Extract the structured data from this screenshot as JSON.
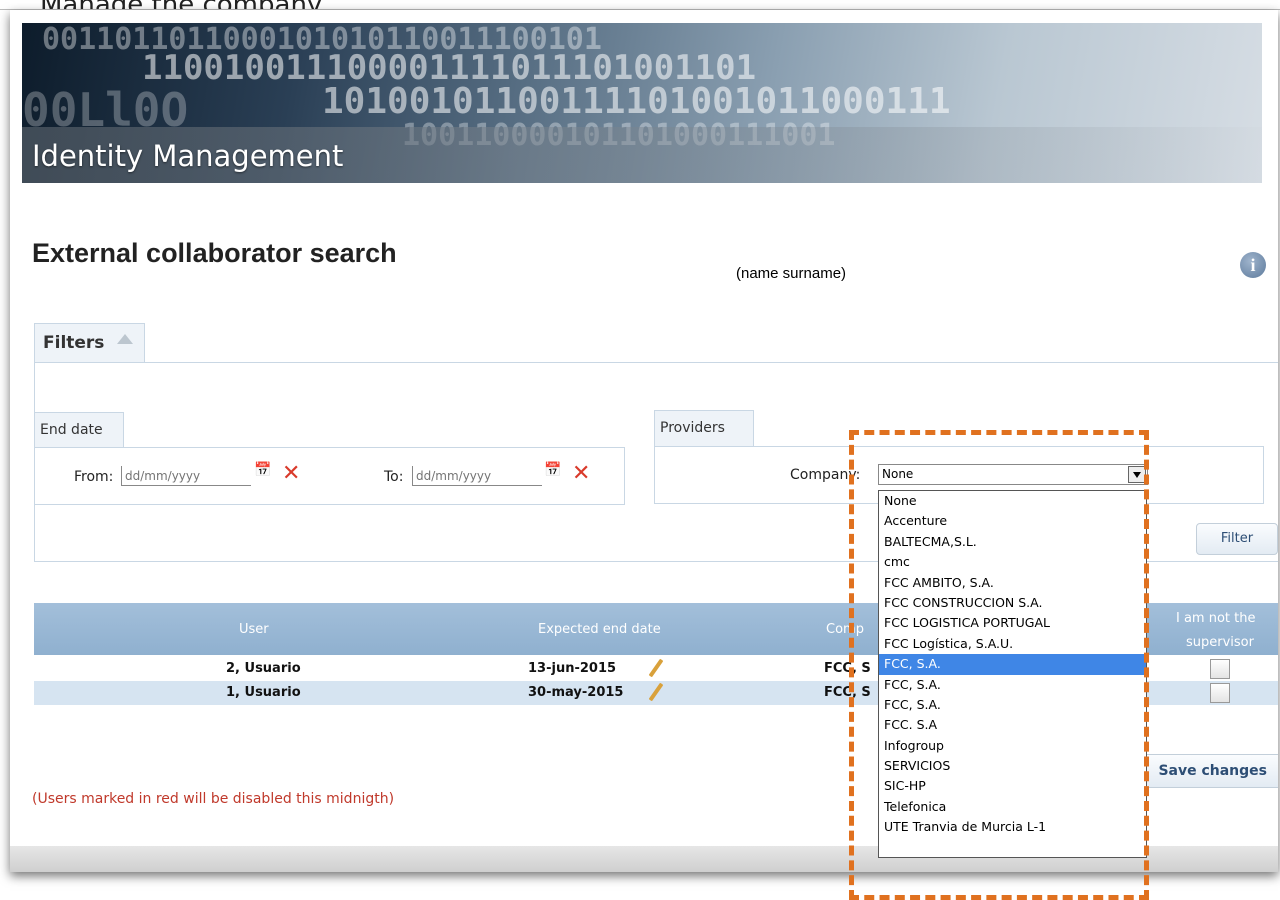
{
  "caption": "Manage the company",
  "banner": {
    "title": "Identity Management"
  },
  "page": {
    "title": "External collaborator search",
    "hint": "(name surname)",
    "info_icon": "i"
  },
  "filters": {
    "tab_label": "Filters",
    "end_date": {
      "legend": "End date",
      "from_label": "From:",
      "from_placeholder": "dd/mm/yyyy",
      "to_label": "To:",
      "to_placeholder": "dd/mm/yyyy"
    },
    "providers": {
      "legend": "Providers",
      "company_label": "Company:",
      "company_selected": "None"
    },
    "filter_button": "Filter"
  },
  "company_options": [
    "None",
    "Accenture",
    "BALTECMA,S.L.",
    "cmc",
    "FCC AMBITO, S.A.",
    "FCC CONSTRUCCION S.A.",
    "FCC LOGISTICA PORTUGAL",
    "FCC Logística, S.A.U.",
    "FCC, S.A.",
    "FCC, S.A.",
    "FCC, S.A.",
    "FCC. S.A",
    "Infogroup",
    "SERVICIOS",
    "SIC-HP",
    "Telefonica",
    "UTE Tranvia de Murcia L-1"
  ],
  "highlighted_option_index": 8,
  "grid": {
    "headers": {
      "user": "User",
      "expected_end": "Expected end date",
      "company": "Comp",
      "not_supervisor_1": "I am not the",
      "not_supervisor_2": "supervisor"
    },
    "rows": [
      {
        "user": "2, Usuario",
        "expected_end": "13-jun-2015",
        "company": "FCC, S"
      },
      {
        "user": "1, Usuario",
        "expected_end": "30-may-2015",
        "company": "FCC, S"
      }
    ]
  },
  "save_button": "Save changes",
  "red_note": "(Users marked in red will be disabled this midnigth)",
  "colors": {
    "accent": "#e0711f",
    "header_blue": "#9ab8d6",
    "row_alt": "#d6e4f1",
    "selected": "#3f86e6",
    "note_red": "#c0392b"
  }
}
